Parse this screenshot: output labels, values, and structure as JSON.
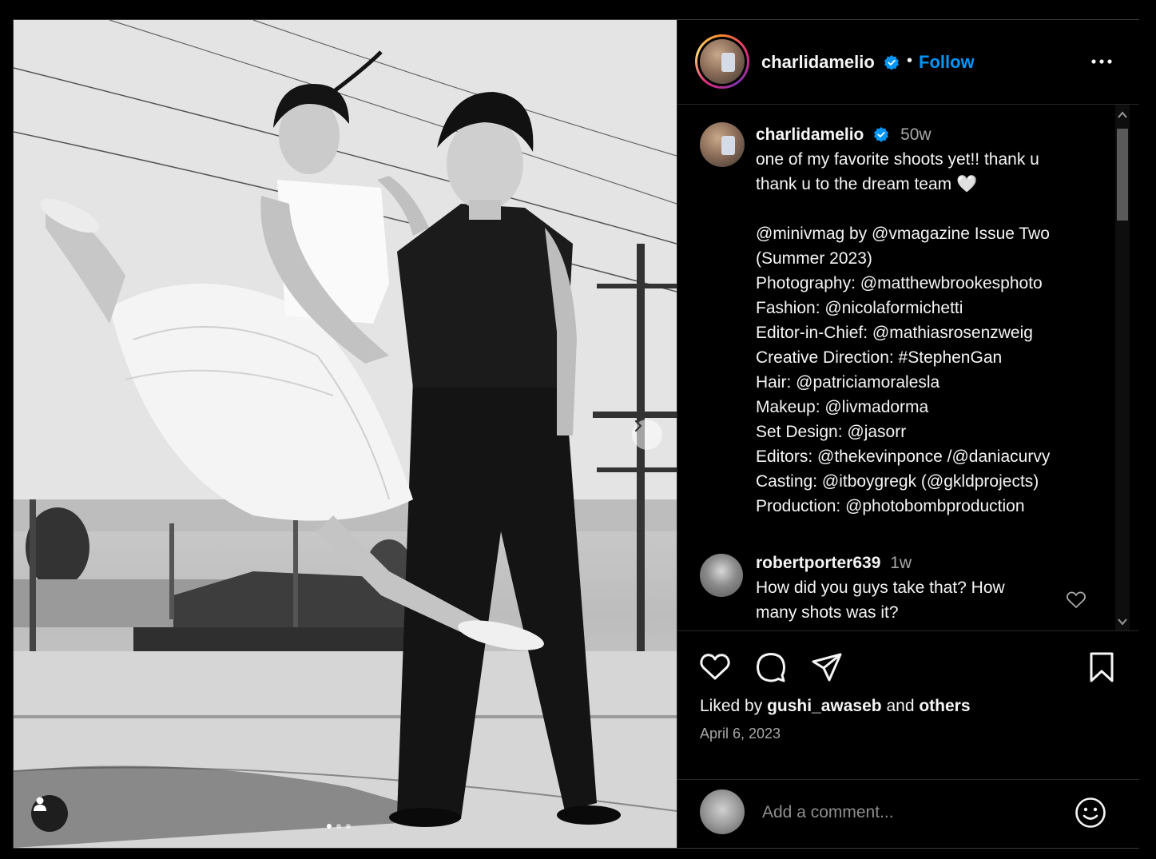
{
  "post": {
    "author": "charlidamelio",
    "follow_label": "Follow",
    "separator": "•",
    "more_icon": "more-horizontal-icon"
  },
  "caption": {
    "username": "charlidamelio",
    "time": "50w",
    "lines": [
      "one of my favorite shoots yet!! thank u",
      "thank u to the dream team 🤍",
      "",
      "@minivmag by @vmagazine Issue Two",
      "(Summer 2023)",
      "Photography: @matthewbrookesphoto",
      "Fashion: @nicolaformichetti",
      "Editor-in-Chief: @mathiasrosenzweig",
      "Creative Direction: #StephenGan",
      "Hair: @patriciamoralesla",
      "Makeup: @livmadorma",
      "Set Design: @jasorr",
      "Editors: @thekevinponce /@daniacurvy",
      "Casting: @itboygregk (@gkldprojects)",
      "Production: @photobombproduction"
    ]
  },
  "comments": [
    {
      "username": "robertporter639",
      "time": "1w",
      "text_lines": [
        "How did you guys take that? How",
        "many shots was it?"
      ]
    }
  ],
  "likes": {
    "prefix": "Liked by ",
    "user": "gushi_awaseb",
    "middle": " and ",
    "others": "others"
  },
  "date": "April 6, 2023",
  "comment_input": {
    "placeholder": "Add a comment..."
  },
  "carousel": {
    "current": 1,
    "total": 3
  },
  "colors": {
    "accent": "#0095f6",
    "background": "#000000",
    "muted": "#a8a8a8",
    "verified": "#0095f6"
  }
}
